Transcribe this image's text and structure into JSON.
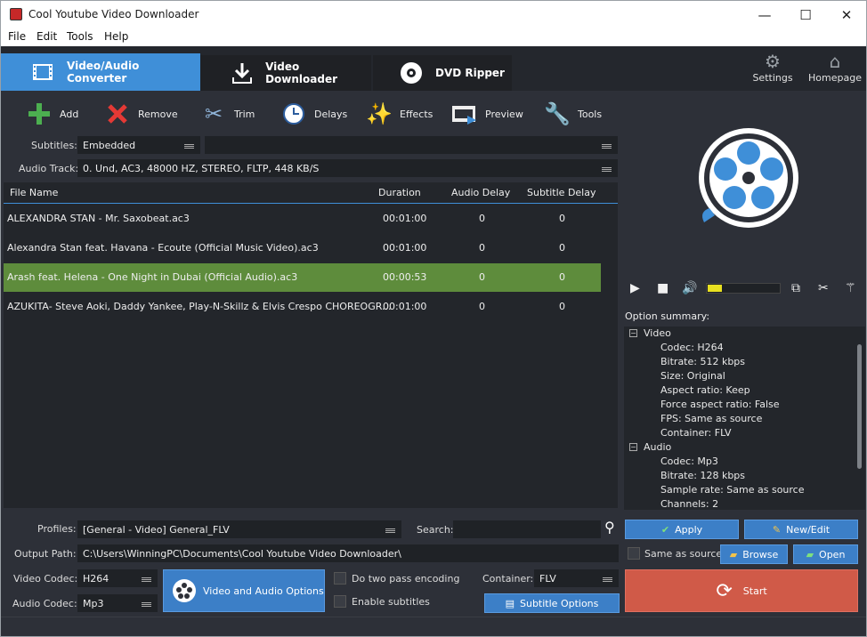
{
  "window": {
    "title": "Cool Youtube Video Downloader",
    "min": "—",
    "max": "☐",
    "close": "✕"
  },
  "menu": [
    "File",
    "Edit",
    "Tools",
    "Help"
  ],
  "tabs": [
    {
      "label": "Video/Audio Converter"
    },
    {
      "label": "Video Downloader"
    },
    {
      "label": "DVD Ripper"
    }
  ],
  "right_buttons": {
    "settings": "Settings",
    "homepage": "Homepage"
  },
  "toolbar": {
    "add": "Add",
    "remove": "Remove",
    "trim": "Trim",
    "delays": "Delays",
    "effects": "Effects",
    "preview": "Preview",
    "tools": "Tools"
  },
  "subtitles": {
    "label": "Subtitles:",
    "value": "Embedded",
    "extra": ""
  },
  "audio_track": {
    "label": "Audio Track:",
    "value": "0. Und, AC3, 48000 HZ, STEREO, FLTP, 448 KB/S"
  },
  "list": {
    "headers": {
      "file": "File Name",
      "duration": "Duration",
      "audio_delay": "Audio Delay",
      "subtitle_delay": "Subtitle Delay"
    },
    "rows": [
      {
        "name": "ALEXANDRA STAN - Mr. Saxobeat.ac3",
        "duration": "00:01:00",
        "audio_delay": "0",
        "subtitle_delay": "0"
      },
      {
        "name": "Alexandra Stan feat. Havana - Ecoute (Official Music Video).ac3",
        "duration": "00:01:00",
        "audio_delay": "0",
        "subtitle_delay": "0"
      },
      {
        "name": "Arash feat. Helena - One Night in Dubai (Official Audio).ac3",
        "duration": "00:00:53",
        "audio_delay": "0",
        "subtitle_delay": "0"
      },
      {
        "name": "AZUKITA- Steve Aoki, Daddy Yankee, Play-N-Skillz & Elvis Crespo CHOREOGR...",
        "duration": "00:01:00",
        "audio_delay": "0",
        "subtitle_delay": "0"
      }
    ]
  },
  "option_summary": {
    "title": "Option summary:",
    "video": {
      "label": "Video",
      "items": [
        "Codec: H264",
        "Bitrate: 512 kbps",
        "Size:  Original",
        "Aspect ratio: Keep",
        "Force aspect ratio: False",
        "FPS: Same as source",
        "Container: FLV"
      ]
    },
    "audio": {
      "label": "Audio",
      "items": [
        "Codec: Mp3",
        "Bitrate: 128 kbps",
        "Sample rate: Same as source",
        "Channels: 2"
      ]
    }
  },
  "player": {
    "volume": 0.2
  },
  "bottom": {
    "profiles_label": "Profiles:",
    "profiles_value": "[General - Video] General_FLV",
    "search_label": "Search:",
    "search_value": "",
    "output_label": "Output Path:",
    "output_value": "C:\\Users\\WinningPC\\Documents\\Cool Youtube Video Downloader\\",
    "video_codec_label": "Video Codec:",
    "video_codec_value": "H264",
    "audio_codec_label": "Audio Codec:",
    "audio_codec_value": "Mp3",
    "va_options": "Video and Audio Options",
    "two_pass": "Do two pass encoding",
    "enable_subs": "Enable subtitles",
    "container_label": "Container:",
    "container_value": "FLV",
    "subtitle_options": "Subtitle Options",
    "apply": "Apply",
    "new_edit": "New/Edit",
    "same_as_source": "Same as source",
    "browse": "Browse",
    "open": "Open",
    "start": "Start"
  },
  "colors": {
    "accent": "#3f8fd8",
    "selected_row": "#5e8c3c",
    "start": "#d05a48",
    "background": "#2d3038"
  }
}
